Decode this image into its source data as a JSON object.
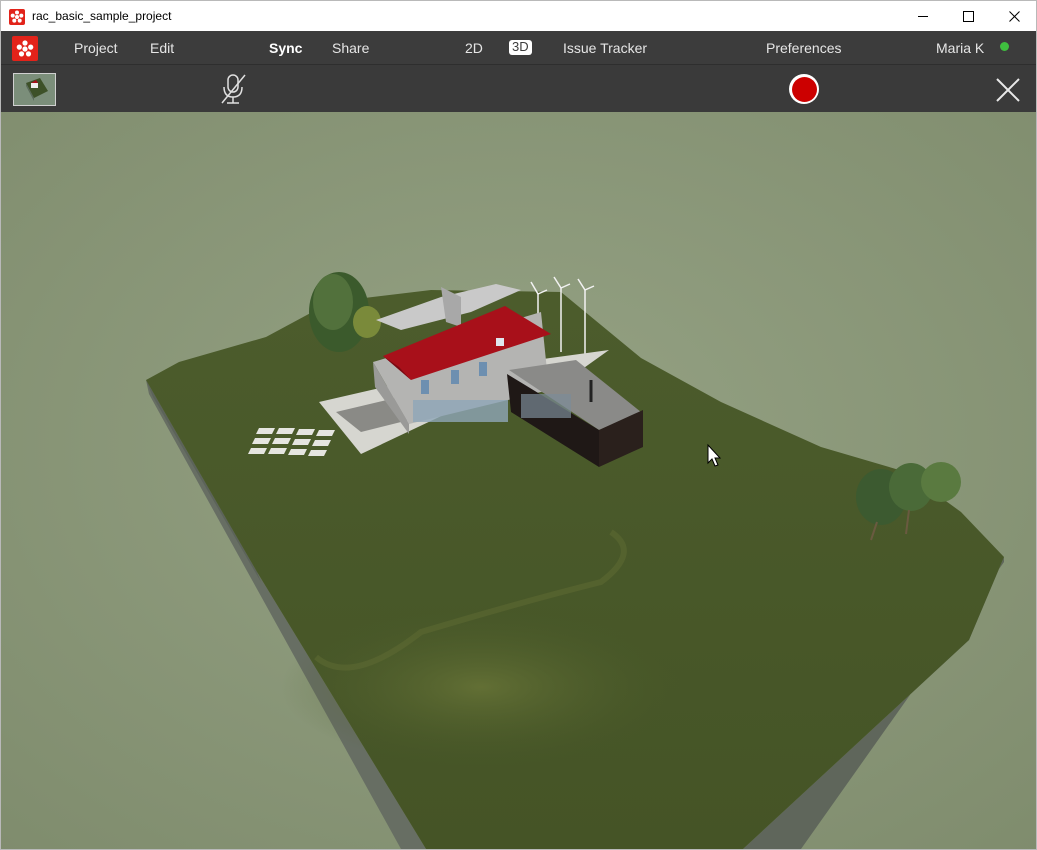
{
  "window": {
    "title": "rac_basic_sample_project"
  },
  "menu": {
    "project": "Project",
    "edit": "Edit",
    "sync": "Sync",
    "share": "Share",
    "view_2d": "2D",
    "view_3d": "3D",
    "issue_tracker": "Issue Tracker",
    "preferences": "Preferences",
    "user": "Maria K"
  },
  "colors": {
    "accent_red": "#e2231a",
    "record_red": "#cc0000",
    "status_online": "#3fbf3f",
    "menubar_bg": "#3c3c3c",
    "sky": "#8e9b7d",
    "grass": "#4a5a2a",
    "roof": "#a8101a"
  },
  "icons": {
    "app": "app-logo-icon",
    "minimize": "minimize-icon",
    "maximize": "maximize-icon",
    "close": "close-icon",
    "mic_muted": "microphone-off-icon",
    "record": "record-icon",
    "exit": "close-x-icon"
  },
  "toolbar": {
    "recording": false,
    "microphone_muted": true
  },
  "viewport": {
    "mode": "3D"
  }
}
